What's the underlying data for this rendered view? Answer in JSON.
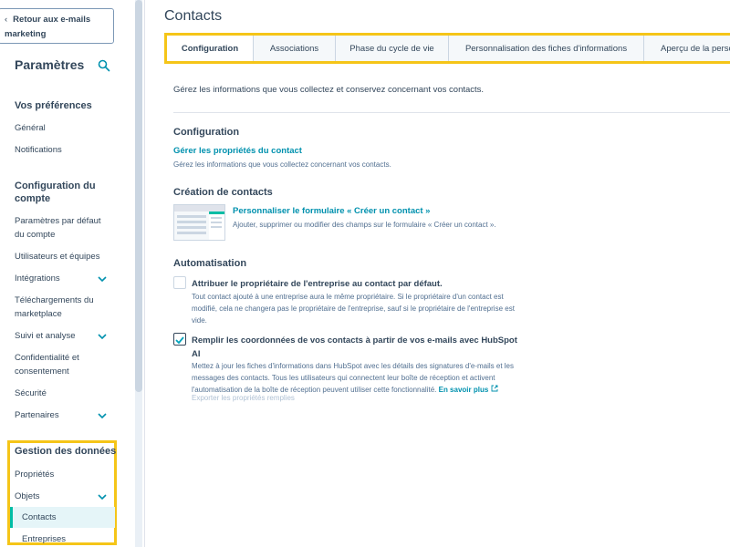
{
  "sidebar": {
    "back_label": "Retour aux e-mails marketing",
    "title": "Paramètres",
    "sections": {
      "preferences": "Vos préférences",
      "account": "Configuration du compte",
      "data": "Gestion des données"
    },
    "items": {
      "general": "Général",
      "notifications": "Notifications",
      "defaults": "Paramètres par défaut du compte",
      "users": "Utilisateurs et équipes",
      "integrations": "Intégrations",
      "downloads": "Téléchargements du marketplace",
      "tracking": "Suivi et analyse",
      "privacy": "Confidentialité et consentement",
      "security": "Sécurité",
      "partners": "Partenaires",
      "properties": "Propriétés",
      "objects": "Objets",
      "contacts": "Contacts",
      "companies": "Entreprises"
    }
  },
  "main": {
    "title": "Contacts",
    "tabs": [
      {
        "label": "Configuration"
      },
      {
        "label": "Associations"
      },
      {
        "label": "Phase du cycle de vie"
      },
      {
        "label": "Personnalisation des fiches d'informations"
      },
      {
        "label": "Aperçu de la personne"
      }
    ],
    "intro": "Gérez les informations que vous collectez et conservez concernant vos contacts.",
    "configuration": {
      "heading": "Configuration",
      "link": "Gérer les propriétés du contact",
      "desc": "Gérez les informations que vous collectez concernant vos contacts."
    },
    "creation": {
      "heading": "Création de contacts",
      "link": "Personnaliser le formulaire « Créer un contact »",
      "desc": "Ajouter, supprimer ou modifier des champs sur le formulaire « Créer un contact »."
    },
    "automation": {
      "heading": "Automatisation",
      "option1": {
        "label": "Attribuer le propriétaire de l'entreprise au contact par défaut.",
        "desc": "Tout contact ajouté à une entreprise aura le même propriétaire. Si le propriétaire d'un contact est modifié, cela ne changera pas le propriétaire de l'entreprise, sauf si le propriétaire de l'entreprise est vide.",
        "checked": false
      },
      "option2": {
        "label": "Remplir les coordonnées de vos contacts à partir de vos e-mails avec HubSpot AI",
        "desc": "Mettez à jour les fiches d'informations dans HubSpot avec les détails des signatures d'e-mails et les messages des contacts. Tous les utilisateurs qui connectent leur boîte de réception et activent l'automatisation de la boîte de réception peuvent utiliser cette fonctionnalité.",
        "learn_more": "En savoir plus",
        "export_link": "Exporter les propriétés remplies",
        "checked": true
      }
    }
  },
  "colors": {
    "accent": "#0091ae",
    "highlight": "#f5c518",
    "text": "#33475b",
    "active_bg": "#e5f5f8"
  }
}
